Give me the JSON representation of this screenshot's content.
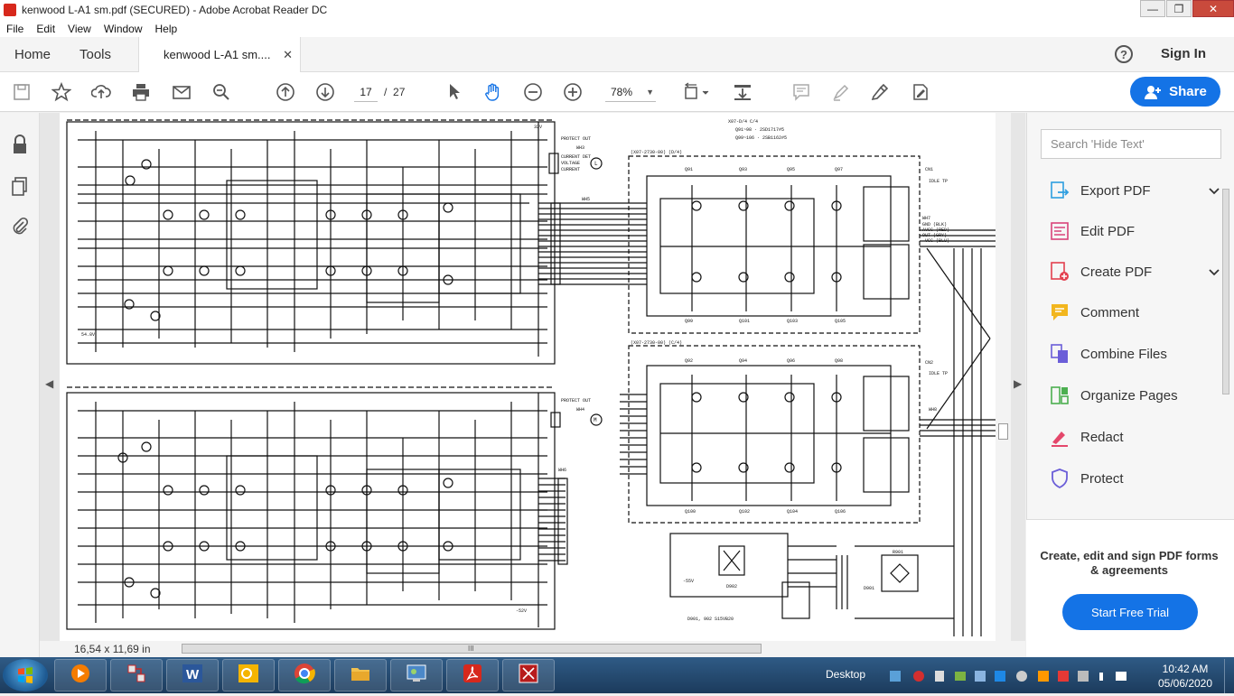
{
  "window": {
    "title": "kenwood L-A1 sm.pdf (SECURED) - Adobe Acrobat Reader DC"
  },
  "menu": [
    "File",
    "Edit",
    "View",
    "Window",
    "Help"
  ],
  "nav": {
    "home": "Home",
    "tools": "Tools",
    "doc_tab": "kenwood L-A1 sm....",
    "help": "?",
    "sign_in": "Sign In"
  },
  "toolbar": {
    "page_current": "17",
    "page_sep": "/",
    "page_total": "27",
    "zoom": "78%",
    "share": "Share"
  },
  "status": {
    "page_size": "16,54 x 11,69 in",
    "scroll_grip": "III"
  },
  "right_pane": {
    "search_placeholder": "Search 'Hide Text'",
    "tools": [
      {
        "label": "Export PDF",
        "icon": "export-pdf-icon",
        "color": "#2d9ee0",
        "expand": "⌄"
      },
      {
        "label": "Edit PDF",
        "icon": "edit-pdf-icon",
        "color": "#d9447a",
        "expand": ""
      },
      {
        "label": "Create PDF",
        "icon": "create-pdf-icon",
        "color": "#e3404f",
        "expand": "⌄"
      },
      {
        "label": "Comment",
        "icon": "comment-icon",
        "color": "#f2b61e",
        "expand": ""
      },
      {
        "label": "Combine Files",
        "icon": "combine-files-icon",
        "color": "#6b5ed8",
        "expand": ""
      },
      {
        "label": "Organize Pages",
        "icon": "organize-pages-icon",
        "color": "#4caf50",
        "expand": ""
      },
      {
        "label": "Redact",
        "icon": "redact-icon",
        "color": "#e4476b",
        "expand": ""
      },
      {
        "label": "Protect",
        "icon": "protect-icon",
        "color": "#6b5ed8",
        "expand": ""
      }
    ],
    "promo": "Create, edit and sign PDF forms & agreements",
    "trial_button": "Start Free Trial"
  },
  "taskbar": {
    "desktop_label": "Desktop",
    "time": "10:42 AM",
    "date": "05/06/2020",
    "apps": [
      "media-player-icon",
      "network-app-icon",
      "word-icon",
      "outlook-icon",
      "chrome-icon",
      "explorer-icon",
      "control-panel-icon",
      "acrobat-icon",
      "acrobat-pro-icon"
    ]
  },
  "schematic": {
    "labels": {
      "top_header": "X07-D/4  C/4",
      "q_top": "Q91~98 · 2SD1717#5",
      "q_bot": "Q99~106 · 2SB1162#5",
      "d4": "(X07-2730-00) (D/4)",
      "c4": "(X07-2730-00) (C/4)",
      "protect_out_1": "PROTECT OUT",
      "protect_out_2": "PROTECT OUT",
      "current_det": "CURRENT DET",
      "voltage": "VOLTAGE",
      "current": "CURRENT",
      "wh3": "WH3",
      "wh4": "WH4",
      "wh5": "WH5",
      "wh6": "WH6",
      "wh7": "WH7",
      "wh8": "WH8",
      "cn1": "CN1",
      "cn2": "CN2",
      "idle_tp1": "IDLE TP",
      "idle_tp2": "IDLE TP",
      "gnd_blk": "GND (BLK)",
      "avcc_red": "AVCC (RED)",
      "out_gry": "OUT (GRY)",
      "vcc_blu": "-VCC (BLU)",
      "d901": "D901, 902   S15VB20",
      "d902": "D902",
      "d901_label": "D901",
      "r901": "R901",
      "v55": "-55V",
      "v32": "32V",
      "v52": "-52V",
      "v54": "54.8V",
      "q_row1": [
        "Q91",
        "Q93",
        "Q95",
        "Q97"
      ],
      "q_row2": [
        "Q99",
        "Q101",
        "Q103",
        "Q105"
      ],
      "q_row3": [
        "Q92",
        "Q94",
        "Q96",
        "Q98"
      ],
      "q_row4": [
        "Q100",
        "Q102",
        "Q104",
        "Q106"
      ],
      "l_mark": "L",
      "m_mark": "M"
    }
  }
}
